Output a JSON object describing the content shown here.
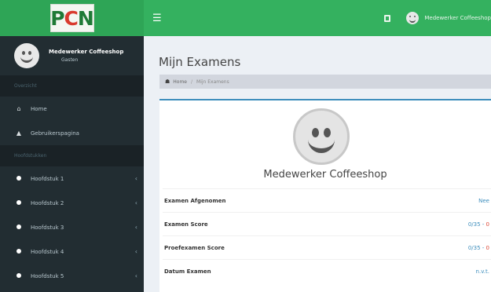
{
  "header": {
    "logo": {
      "p": "P",
      "c": "C",
      "n": "N"
    },
    "menu_icon": "☰",
    "user_name": "Medewerker Coffeeshop"
  },
  "sidebar": {
    "user": {
      "name": "Medewerker Coffeeshop",
      "status": "Gasten"
    },
    "section_1": "Overzicht",
    "items_1": [
      {
        "label": "Home",
        "icon": "home-icon"
      },
      {
        "label": "Gebruikerspagina",
        "icon": "user-icon"
      }
    ],
    "section_2": "Hoofdstukken",
    "chapters": [
      {
        "label": "Hoofdstuk 1"
      },
      {
        "label": "Hoofdstuk 2"
      },
      {
        "label": "Hoofdstuk 3"
      },
      {
        "label": "Hoofdstuk 4"
      },
      {
        "label": "Hoofdstuk 5"
      }
    ]
  },
  "main": {
    "title": "Mijn Examens",
    "breadcrumb": {
      "home": "Home",
      "current": "Mijn Examens"
    },
    "profile_name": "Medewerker Coffeeshop",
    "rows": [
      {
        "label": "Examen Afgenomen",
        "value": "Nee",
        "value_red": ""
      },
      {
        "label": "Examen Score",
        "value": "0/35 - ",
        "value_red": "0"
      },
      {
        "label": "Proefexamen Score",
        "value": "0/35 - ",
        "value_red": "0"
      },
      {
        "label": "Datum Examen",
        "value": "n.v.t.",
        "value_red": ""
      }
    ]
  },
  "colors": {
    "header_green": "#34b15f",
    "logo_green": "#2ea556",
    "sidebar_dark": "#222d32",
    "accent_blue": "#3c8dbc",
    "score_red": "#dd4b39"
  }
}
